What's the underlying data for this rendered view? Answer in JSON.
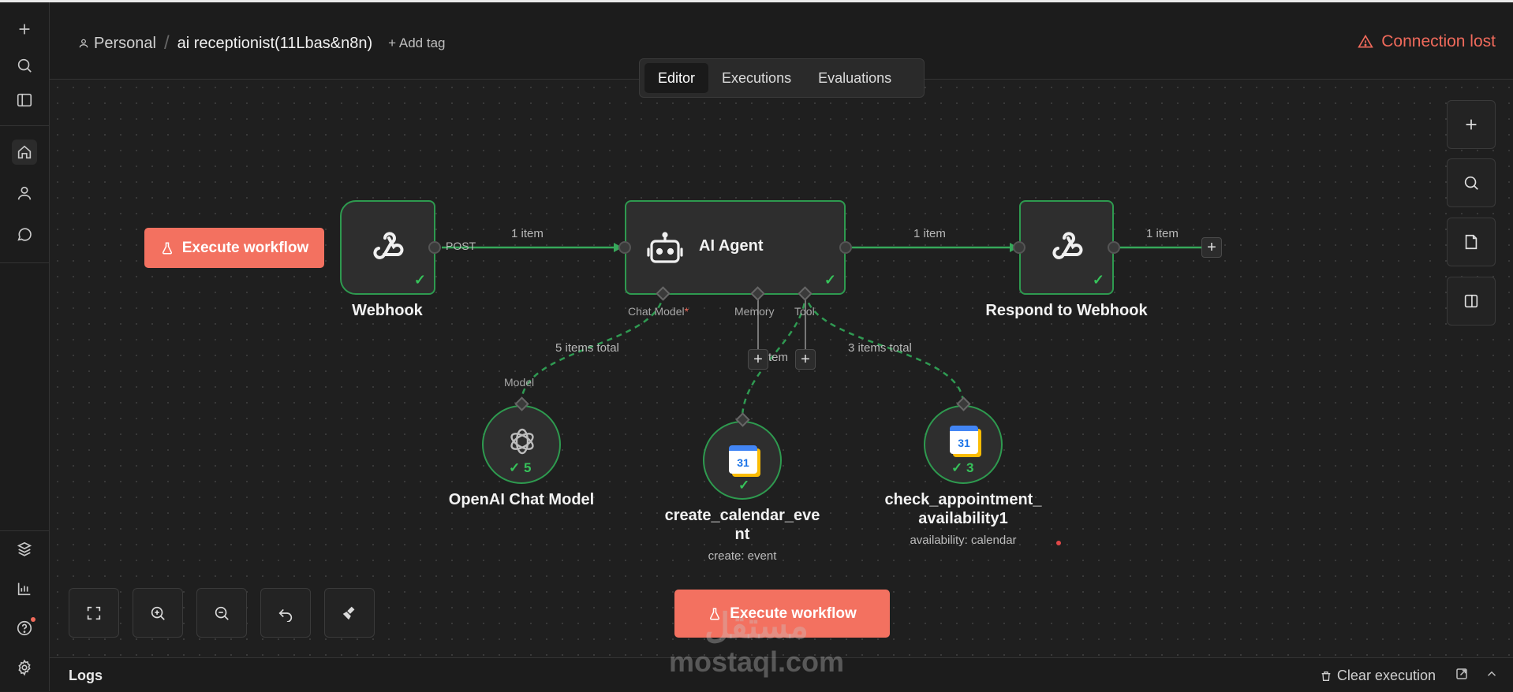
{
  "header": {
    "project": "Personal",
    "workflow_name": "ai receptionist(11Lbas&n8n)",
    "add_tag": "+ Add tag",
    "connection_status": "Connection lost",
    "tabs": [
      {
        "label": "Editor",
        "active": true
      },
      {
        "label": "Executions",
        "active": false
      },
      {
        "label": "Evaluations",
        "active": false
      }
    ]
  },
  "sidebar": {
    "top_icons": [
      "plus-icon",
      "search-icon",
      "panel-icon"
    ],
    "nav_icons": [
      "home-icon",
      "user-icon",
      "chat-icon"
    ],
    "bottom_icons": [
      "templates-icon",
      "insights-icon",
      "help-icon",
      "settings-icon"
    ]
  },
  "canvas": {
    "execute_button_left": "Execute workflow",
    "execute_button_bottom": "Execute workflow",
    "nodes": {
      "webhook": {
        "label": "Webhook"
      },
      "ai_agent": {
        "label": "AI Agent"
      },
      "respond": {
        "label": "Respond to Webhook"
      },
      "openai": {
        "label": "OpenAI Chat Model",
        "count": "5"
      },
      "create_event": {
        "label_line1": "create_calendar_eve",
        "label_line2": "nt",
        "subtitle": "create: event"
      },
      "check_avail": {
        "label_line1": "check_appointment_",
        "label_line2": "availability1",
        "subtitle": "availability: calendar",
        "count": "3"
      }
    },
    "edge_labels": {
      "post": "POST",
      "webhook_to_agent": "1 item",
      "agent_to_respond": "1 item",
      "respond_out": "1 item",
      "model_edge": "5 items total",
      "tool_edge": "3 items total",
      "tool_mid": "tem"
    },
    "handles": {
      "chat_model": "Chat Model",
      "required_mark": "*",
      "memory": "Memory",
      "tool": "Tool",
      "model": "Model"
    }
  },
  "logs": {
    "title": "Logs",
    "clear": "Clear execution"
  },
  "watermark": {
    "arabic": "مستقل",
    "latin": "mostaql.com"
  },
  "colors": {
    "accent": "#f37160",
    "success": "#2e9a4f",
    "danger": "#f06a5b",
    "background": "#1f1f1f"
  }
}
